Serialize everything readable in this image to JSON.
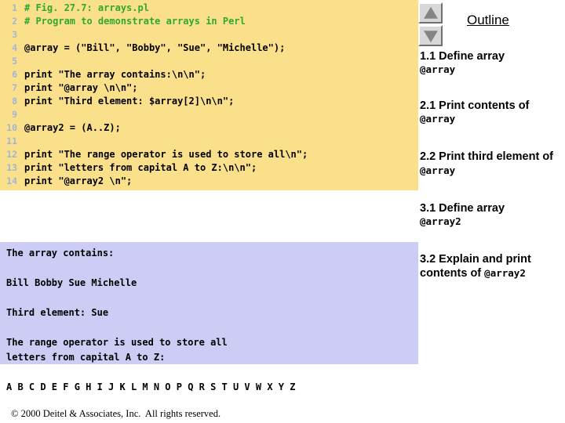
{
  "code_panel": {
    "lines": [
      {
        "num": "1",
        "text": "# Fig. 27.7: arrays.pl",
        "comment": true
      },
      {
        "num": "2",
        "text": "# Program to demonstrate arrays in Perl",
        "comment": true
      },
      {
        "num": "3",
        "text": "",
        "comment": false
      },
      {
        "num": "4",
        "text": "@array = (\"Bill\", \"Bobby\", \"Sue\", \"Michelle\");",
        "comment": false
      },
      {
        "num": "5",
        "text": "",
        "comment": false
      },
      {
        "num": "6",
        "text": "print \"The array contains:\\n\\n\";",
        "comment": false
      },
      {
        "num": "7",
        "text": "print \"@array \\n\\n\";",
        "comment": false
      },
      {
        "num": "8",
        "text": "print \"Third element: $array[2]\\n\\n\";",
        "comment": false
      },
      {
        "num": "9",
        "text": "",
        "comment": false
      },
      {
        "num": "10",
        "text": "@array2 = (A..Z);",
        "comment": false
      },
      {
        "num": "11",
        "text": "",
        "comment": false
      },
      {
        "num": "12",
        "text": "print \"The range operator is used to store all\\n\";",
        "comment": false
      },
      {
        "num": "13",
        "text": "print \"letters from capital A to Z:\\n\\n\";",
        "comment": false
      },
      {
        "num": "14",
        "text": "print \"@array2 \\n\";",
        "comment": false
      }
    ]
  },
  "output_panel": {
    "lines": [
      "The array contains:",
      "",
      "Bill Bobby Sue Michelle",
      "",
      "Third element: Sue",
      "",
      "The range operator is used to store all",
      "letters from capital A to Z:",
      "",
      "A B C D E F G H I J K L M N O P Q R S T U V W X Y Z"
    ]
  },
  "outline": {
    "title": "Outline",
    "nav_up_label": "scroll-up",
    "nav_down_label": "scroll-down",
    "items": [
      {
        "head": "1.1 Define array",
        "mono": "@array",
        "inline": false
      },
      {
        "head": "2.1 Print contents of",
        "mono": "@array",
        "inline": false
      },
      {
        "head": "2.2 Print third element of ",
        "mono": "@array",
        "inline": true
      },
      {
        "head": "3.1 Define array",
        "mono": "@array2",
        "inline": false
      },
      {
        "head": "3.2 Explain and print contents of ",
        "mono": "@array2",
        "inline": true
      }
    ]
  },
  "footer": {
    "text": "© 2000 Deitel & Associates, Inc.  All rights reserved."
  },
  "colors": {
    "code_background": "#fbe08c",
    "output_background": "#ccccf5",
    "comment_green": "#2fa82f",
    "line_number": "#9fb6d4",
    "button_face": "#d8d8d8",
    "triangle": "#858585"
  }
}
